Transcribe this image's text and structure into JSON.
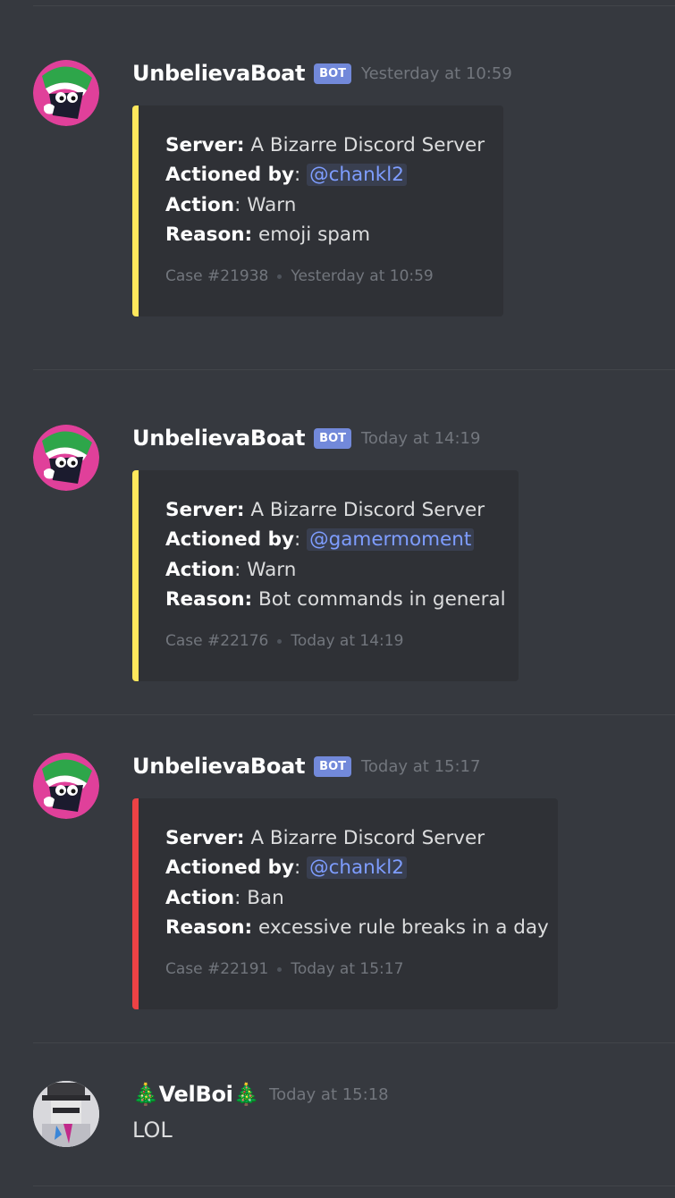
{
  "messages": [
    {
      "username": "UnbelievaBoat",
      "bot_tag": "BOT",
      "timestamp": "Yesterday at 10:59",
      "accent_color": "#fee75c",
      "fields": {
        "server_label": "Server:",
        "server_value": "A Bizarre Discord Server",
        "actioned_label": "Actioned by",
        "actioned_value": "@chankl2",
        "action_label": "Action",
        "action_value": "Warn",
        "reason_label": "Reason:",
        "reason_value": "emoji spam"
      },
      "footer_case": "Case #21938",
      "footer_time": "Yesterday at 10:59"
    },
    {
      "username": "UnbelievaBoat",
      "bot_tag": "BOT",
      "timestamp": "Today at 14:19",
      "accent_color": "#fee75c",
      "fields": {
        "server_label": "Server:",
        "server_value": "A Bizarre Discord Server",
        "actioned_label": "Actioned by",
        "actioned_value": "@gamermoment",
        "action_label": "Action",
        "action_value": "Warn",
        "reason_label": "Reason:",
        "reason_value": "Bot commands in general"
      },
      "footer_case": "Case #22176",
      "footer_time": "Today at 14:19"
    },
    {
      "username": "UnbelievaBoat",
      "bot_tag": "BOT",
      "timestamp": "Today at 15:17",
      "accent_color": "#ed4245",
      "fields": {
        "server_label": "Server:",
        "server_value": "A Bizarre Discord Server",
        "actioned_label": "Actioned by",
        "actioned_value": "@chankl2",
        "action_label": "Action",
        "action_value": "Ban",
        "reason_label": "Reason:",
        "reason_value": "excessive rule breaks in a day"
      },
      "footer_case": "Case #22191",
      "footer_time": "Today at 15:17"
    }
  ],
  "user_message": {
    "username": "🎄VelBoi🎄",
    "timestamp": "Today at 15:18",
    "content": "LOL"
  },
  "icons": {
    "bot_avatar": "bot-avatar",
    "user_avatar": "user-avatar"
  }
}
